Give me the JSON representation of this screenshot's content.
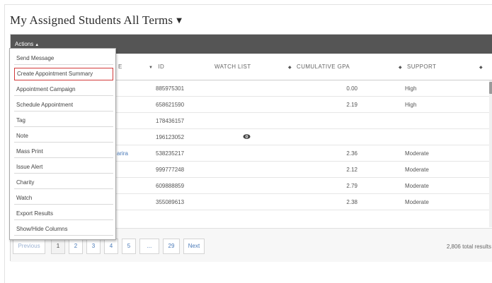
{
  "page_title": "My Assigned Students All Terms",
  "actions_label": "Actions",
  "columns": {
    "name_partial": "E",
    "id": "ID",
    "watch_list": "WATCH LIST",
    "gpa": "CUMULATIVE GPA",
    "support": "SUPPORT"
  },
  "rows": [
    {
      "id": "885975301",
      "gpa": "0.00",
      "support": "High",
      "watch": false,
      "name_partial": ""
    },
    {
      "id": "658621590",
      "gpa": "2.19",
      "support": "High",
      "watch": false,
      "name_partial": ""
    },
    {
      "id": "178436157",
      "gpa": "",
      "support": "",
      "watch": false,
      "name_partial": ""
    },
    {
      "id": "196123052",
      "gpa": "",
      "support": "",
      "watch": true,
      "name_partial": ""
    },
    {
      "id": "538235217",
      "gpa": "2.36",
      "support": "Moderate",
      "watch": false,
      "name_partial": "arira"
    },
    {
      "id": "999777248",
      "gpa": "2.12",
      "support": "Moderate",
      "watch": false,
      "name_partial": ""
    },
    {
      "id": "609888859",
      "gpa": "2.79",
      "support": "Moderate",
      "watch": false,
      "name_partial": ""
    },
    {
      "id": "355089613",
      "gpa": "2.38",
      "support": "Moderate",
      "watch": false,
      "name_partial": ""
    }
  ],
  "actions_menu": [
    "Send Message",
    "Create Appointment Summary",
    "Appointment Campaign",
    "Schedule Appointment",
    "Tag",
    "Note",
    "Mass Print",
    "Issue Alert",
    "Charity",
    "Watch",
    "Export Results",
    "Show/Hide Columns"
  ],
  "highlighted_menu_item": "Create Appointment Summary",
  "pagination": {
    "previous": "Previous",
    "pages": [
      "1",
      "2",
      "3",
      "4",
      "5",
      "...",
      "29"
    ],
    "current": "1",
    "next": "Next"
  },
  "total_results": "2,806 total results",
  "colors": {
    "toolbar": "#555555",
    "link": "#4a7ab8",
    "highlight_border": "#d23a3a"
  }
}
